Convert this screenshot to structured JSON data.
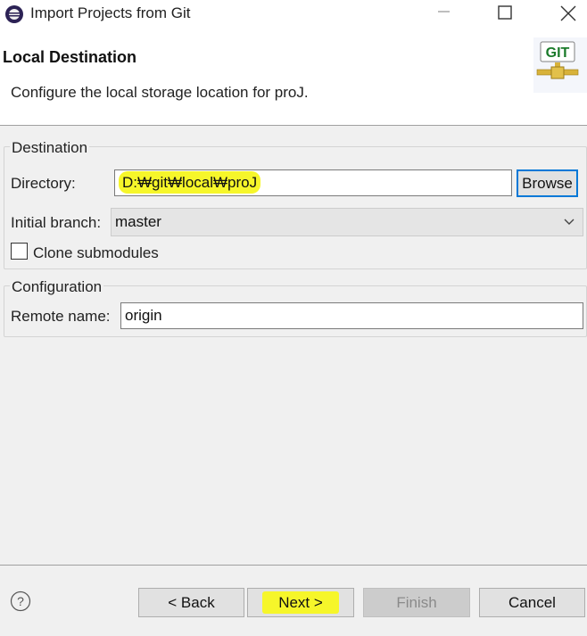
{
  "window": {
    "title": "Import Projects from Git",
    "icons": [
      "eclipse-icon",
      "minimize-icon",
      "maximize-icon",
      "close-icon"
    ]
  },
  "header": {
    "title": "Local Destination",
    "description": "Configure the local storage location for proJ.",
    "logo_text": "GIT"
  },
  "destination": {
    "group_title": "Destination",
    "directory_label": "Directory:",
    "directory_value": "D:₩git₩local₩proJ",
    "browse_label": "Browse",
    "branch_label": "Initial branch:",
    "branch_value": "master",
    "clone_submodules_label": "Clone submodules",
    "clone_submodules_checked": false
  },
  "configuration": {
    "group_title": "Configuration",
    "remote_label": "Remote name:",
    "remote_value": "origin"
  },
  "footer": {
    "back_label": "< Back",
    "next_label": "Next >",
    "finish_label": "Finish",
    "cancel_label": "Cancel",
    "help_icon": "help-icon"
  },
  "colors": {
    "highlight": "#f6f62a",
    "focus_border": "#0078d7",
    "dialog_bg": "#f0f0f0"
  }
}
